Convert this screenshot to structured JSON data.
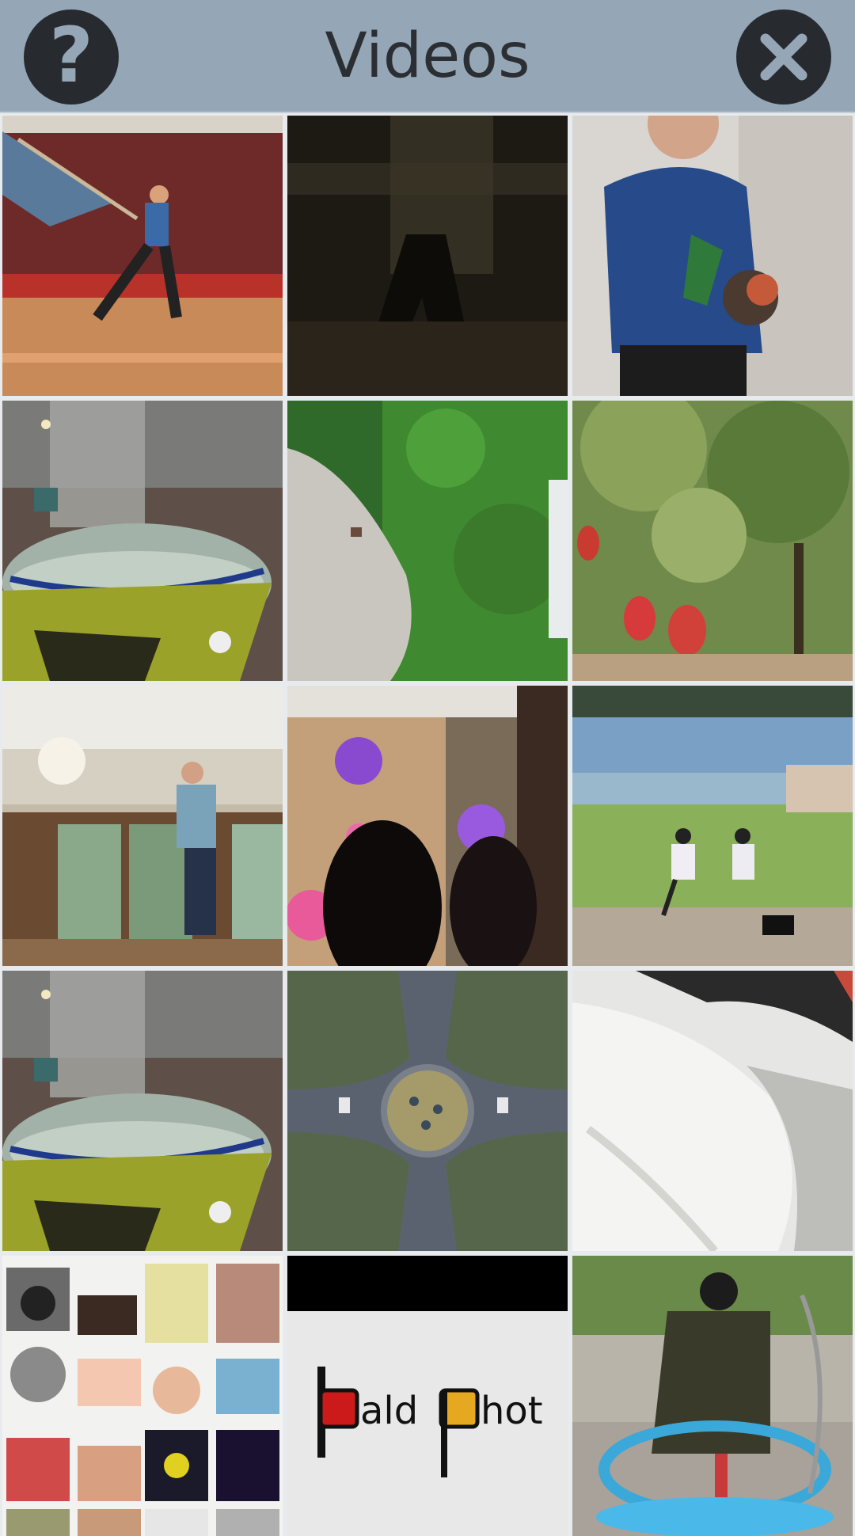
{
  "header": {
    "title": "Videos",
    "help_icon": "help-icon",
    "close_icon": "close-icon",
    "background_color": "#95a7b7",
    "button_color": "#272b30"
  },
  "thumbnails": {
    "logo_thumbnail_text": "BaldPhot"
  }
}
